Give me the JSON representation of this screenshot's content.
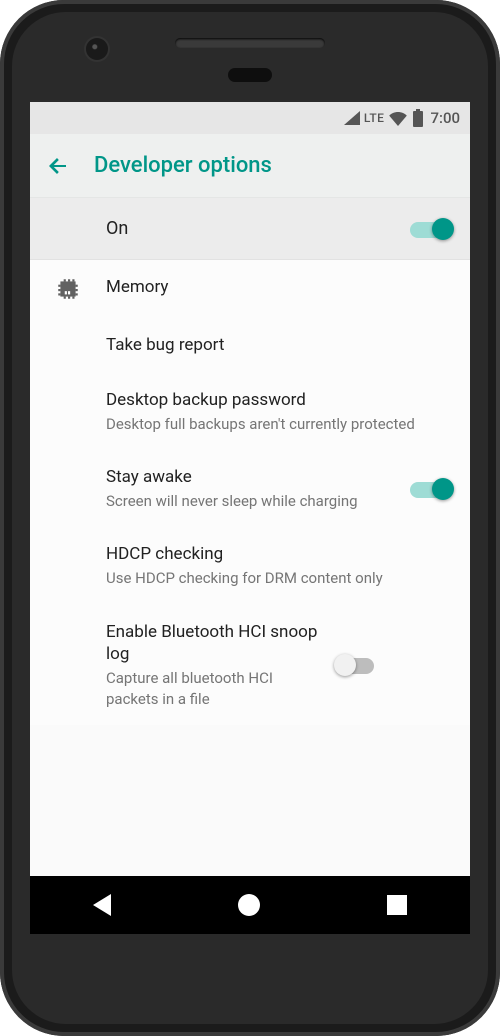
{
  "statusBar": {
    "network": "LTE",
    "time": "7:00"
  },
  "appBar": {
    "title": "Developer options"
  },
  "master": {
    "label": "On",
    "enabled": true
  },
  "items": {
    "memory": {
      "title": "Memory"
    },
    "bugreport": {
      "title": "Take bug report"
    },
    "backup": {
      "title": "Desktop backup password",
      "subtitle": "Desktop full backups aren't currently protected"
    },
    "stayawake": {
      "title": "Stay awake",
      "subtitle": "Screen will never sleep while charging",
      "enabled": true
    },
    "hdcp": {
      "title": "HDCP checking",
      "subtitle": "Use HDCP checking for DRM content only"
    },
    "bthci": {
      "title": "Enable Bluetooth HCI snoop log",
      "subtitle": "Capture all bluetooth HCI packets in a file",
      "enabled": false
    }
  }
}
